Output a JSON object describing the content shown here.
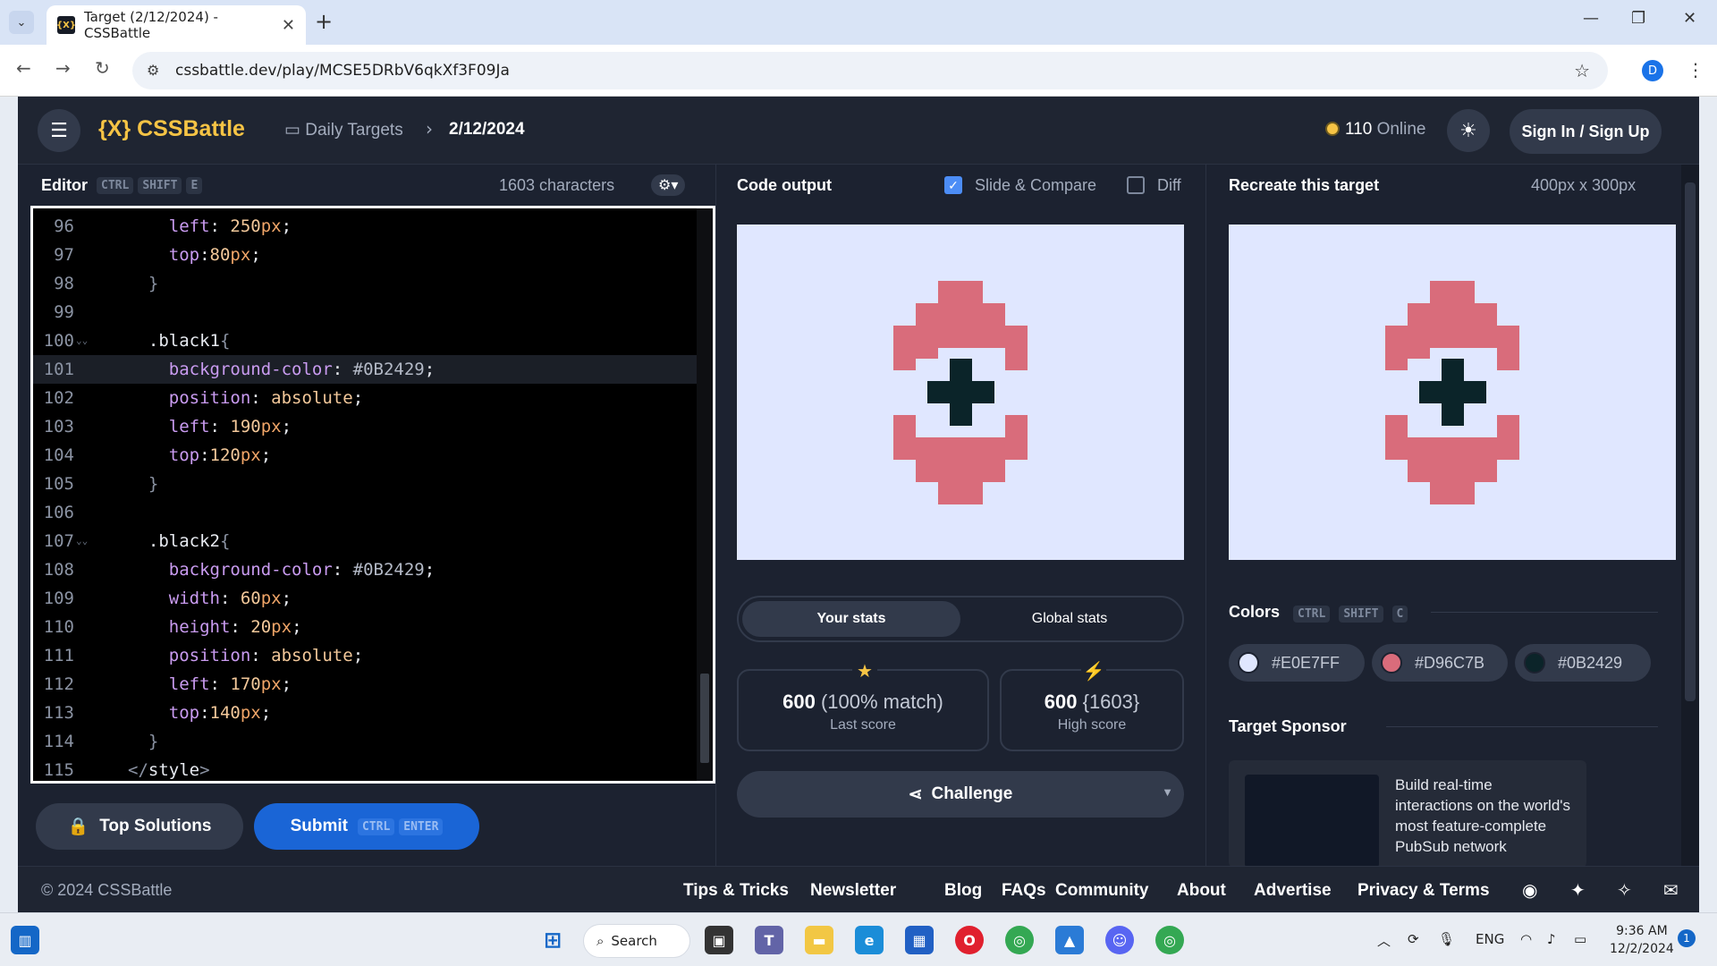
{
  "browser": {
    "tab_title": "Target (2/12/2024) - CSSBattle",
    "tab_favicon": "{X}",
    "url": "cssbattle.dev/play/MCSE5DRbV6qkXf3F09Ja",
    "profile_initial": "D"
  },
  "header": {
    "logo": "{X} CSSBattle",
    "breadcrumb": "Daily Targets",
    "date": "2/12/2024",
    "online_count": "110",
    "online_label": "Online",
    "sign_in": "Sign In / Sign Up"
  },
  "editor": {
    "title": "Editor",
    "shortcut": [
      "CTRL",
      "SHIFT",
      "E"
    ],
    "char_count": "1603 characters",
    "lines": [
      {
        "n": "96",
        "t": [
          [
            "p",
            "    left"
          ],
          [
            "s",
            ": "
          ],
          [
            "v",
            "250"
          ],
          [
            "u",
            "px"
          ],
          [
            "s",
            ";"
          ]
        ]
      },
      {
        "n": "97",
        "t": [
          [
            "p",
            "    top"
          ],
          [
            "s",
            ":"
          ],
          [
            "v",
            "80"
          ],
          [
            "u",
            "px"
          ],
          [
            "s",
            ";"
          ]
        ]
      },
      {
        "n": "98",
        "t": [
          [
            "br",
            "  }"
          ]
        ]
      },
      {
        "n": "99",
        "t": []
      },
      {
        "n": "100",
        "fold": true,
        "t": [
          [
            "s",
            "  .black1"
          ],
          [
            "br",
            "{"
          ]
        ]
      },
      {
        "n": "101",
        "active": true,
        "t": [
          [
            "p",
            "    background-color"
          ],
          [
            "s",
            ": "
          ],
          [
            "h",
            "#0B2429"
          ],
          [
            "s",
            ";"
          ]
        ]
      },
      {
        "n": "102",
        "t": [
          [
            "p",
            "    position"
          ],
          [
            "s",
            ": "
          ],
          [
            "v",
            "absolute"
          ],
          [
            "s",
            ";"
          ]
        ]
      },
      {
        "n": "103",
        "t": [
          [
            "p",
            "    left"
          ],
          [
            "s",
            ": "
          ],
          [
            "v",
            "190"
          ],
          [
            "u",
            "px"
          ],
          [
            "s",
            ";"
          ]
        ]
      },
      {
        "n": "104",
        "t": [
          [
            "p",
            "    top"
          ],
          [
            "s",
            ":"
          ],
          [
            "v",
            "120"
          ],
          [
            "u",
            "px"
          ],
          [
            "s",
            ";"
          ]
        ]
      },
      {
        "n": "105",
        "t": [
          [
            "br",
            "  }"
          ]
        ]
      },
      {
        "n": "106",
        "t": []
      },
      {
        "n": "107",
        "fold": true,
        "t": [
          [
            "s",
            "  .black2"
          ],
          [
            "br",
            "{"
          ]
        ]
      },
      {
        "n": "108",
        "t": [
          [
            "p",
            "    background-color"
          ],
          [
            "s",
            ": "
          ],
          [
            "h",
            "#0B2429"
          ],
          [
            "s",
            ";"
          ]
        ]
      },
      {
        "n": "109",
        "t": [
          [
            "p",
            "    width"
          ],
          [
            "s",
            ": "
          ],
          [
            "v",
            "60"
          ],
          [
            "u",
            "px"
          ],
          [
            "s",
            ";"
          ]
        ]
      },
      {
        "n": "110",
        "t": [
          [
            "p",
            "    height"
          ],
          [
            "s",
            ": "
          ],
          [
            "v",
            "20"
          ],
          [
            "u",
            "px"
          ],
          [
            "s",
            ";"
          ]
        ]
      },
      {
        "n": "111",
        "t": [
          [
            "p",
            "    position"
          ],
          [
            "s",
            ": "
          ],
          [
            "v",
            "absolute"
          ],
          [
            "s",
            ";"
          ]
        ]
      },
      {
        "n": "112",
        "t": [
          [
            "p",
            "    left"
          ],
          [
            "s",
            ": "
          ],
          [
            "v",
            "170"
          ],
          [
            "u",
            "px"
          ],
          [
            "s",
            ";"
          ]
        ]
      },
      {
        "n": "113",
        "t": [
          [
            "p",
            "    top"
          ],
          [
            "s",
            ":"
          ],
          [
            "v",
            "140"
          ],
          [
            "u",
            "px"
          ],
          [
            "s",
            ";"
          ]
        ]
      },
      {
        "n": "114",
        "t": [
          [
            "br",
            "  }"
          ]
        ]
      },
      {
        "n": "115",
        "t": [
          [
            "br",
            "</"
          ],
          [
            "s",
            "style"
          ],
          [
            "br",
            ">"
          ]
        ]
      }
    ],
    "top_solutions": "Top Solutions",
    "submit": "Submit",
    "submit_shortcut": [
      "CTRL",
      "ENTER"
    ]
  },
  "output": {
    "title": "Code output",
    "slide_compare": "Slide & Compare",
    "diff": "Diff",
    "stats_tabs": [
      "Your stats",
      "Global stats"
    ],
    "last_score_value": "600",
    "last_score_match": "(100% match)",
    "last_score_label": "Last score",
    "high_score_value": "600",
    "high_score_chars": "{1603}",
    "high_score_label": "High score",
    "challenge": "Challenge"
  },
  "target": {
    "title": "Recreate this target",
    "size": "400px x 300px",
    "colors_title": "Colors",
    "colors_shortcut": [
      "CTRL",
      "SHIFT",
      "C"
    ],
    "colors": [
      {
        "hex": "#E0E7FF",
        "label": "#E0E7FF"
      },
      {
        "hex": "#D96C7B",
        "label": "#D96C7B"
      },
      {
        "hex": "#0B2429",
        "label": "#0B2429"
      }
    ],
    "sponsor_title": "Target Sponsor",
    "sponsor_text": "Build real-time interactions on the world's most feature-complete PubSub network"
  },
  "footer": {
    "copyright": "© 2024 CSSBattle",
    "links": [
      "Tips & Tricks",
      "Newsletter",
      "Blog",
      "FAQs",
      "Community",
      "About",
      "Advertise",
      "Privacy & Terms"
    ]
  },
  "taskbar": {
    "search": "Search",
    "lang": "ENG",
    "time": "9:36 AM",
    "date": "12/2/2024",
    "notif": "1"
  }
}
